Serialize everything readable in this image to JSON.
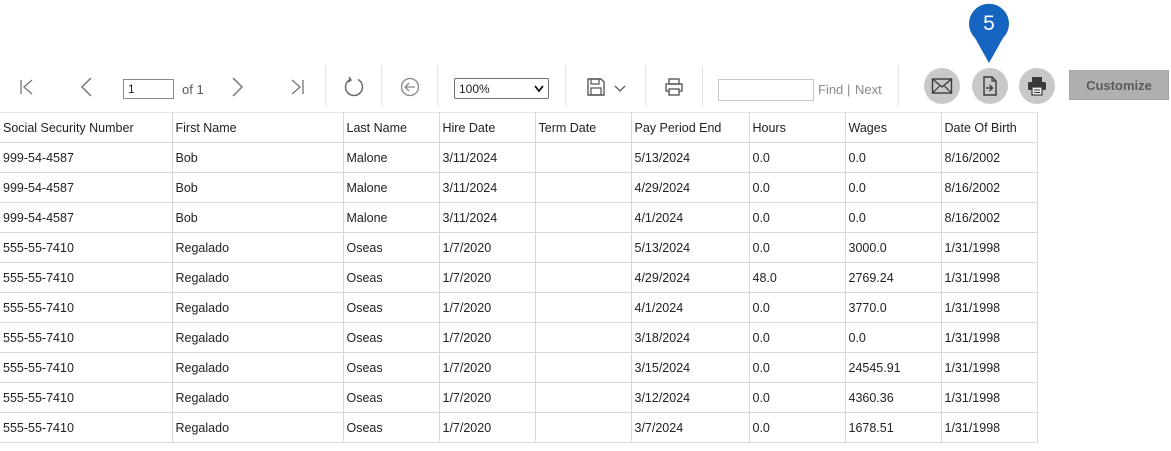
{
  "annotation": {
    "number": "5",
    "color": "#1565c0"
  },
  "toolbar": {
    "icons": {
      "first_page": "first-page-icon",
      "prev_page": "prev-page-icon",
      "next_page": "next-page-icon",
      "last_page": "last-page-icon",
      "refresh": "refresh-icon",
      "back": "back-circle-icon",
      "save": "save-disk-icon",
      "print": "print-icon",
      "email": "email-icon",
      "export": "export-file-icon",
      "printer_round": "printer-icon"
    },
    "page_number": "1",
    "of_pages": "of 1",
    "zoom": "100%",
    "find_label": "Find",
    "separator": "|",
    "next_label": "Next",
    "customize_label": "Customize"
  },
  "table": {
    "columns": [
      "Social Security Number",
      "First Name",
      "Last Name",
      "Hire Date",
      "Term Date",
      "Pay Period End",
      "Hours",
      "Wages",
      "Date Of Birth"
    ],
    "rows": [
      [
        "999-54-4587",
        "Bob",
        "Malone",
        "3/11/2024",
        "",
        "5/13/2024",
        "0.0",
        "0.0",
        "8/16/2002"
      ],
      [
        "999-54-4587",
        "Bob",
        "Malone",
        "3/11/2024",
        "",
        "4/29/2024",
        "0.0",
        "0.0",
        "8/16/2002"
      ],
      [
        "999-54-4587",
        "Bob",
        "Malone",
        "3/11/2024",
        "",
        "4/1/2024",
        "0.0",
        "0.0",
        "8/16/2002"
      ],
      [
        "555-55-7410",
        "Regalado",
        "Oseas",
        "1/7/2020",
        "",
        "5/13/2024",
        "0.0",
        "3000.0",
        "1/31/1998"
      ],
      [
        "555-55-7410",
        "Regalado",
        "Oseas",
        "1/7/2020",
        "",
        "4/29/2024",
        "48.0",
        "2769.24",
        "1/31/1998"
      ],
      [
        "555-55-7410",
        "Regalado",
        "Oseas",
        "1/7/2020",
        "",
        "4/1/2024",
        "0.0",
        "3770.0",
        "1/31/1998"
      ],
      [
        "555-55-7410",
        "Regalado",
        "Oseas",
        "1/7/2020",
        "",
        "3/18/2024",
        "0.0",
        "0.0",
        "1/31/1998"
      ],
      [
        "555-55-7410",
        "Regalado",
        "Oseas",
        "1/7/2020",
        "",
        "3/15/2024",
        "0.0",
        "24545.91",
        "1/31/1998"
      ],
      [
        "555-55-7410",
        "Regalado",
        "Oseas",
        "1/7/2020",
        "",
        "3/12/2024",
        "0.0",
        "4360.36",
        "1/31/1998"
      ],
      [
        "555-55-7410",
        "Regalado",
        "Oseas",
        "1/7/2020",
        "",
        "3/7/2024",
        "0.0",
        "1678.51",
        "1/31/1998"
      ]
    ]
  }
}
